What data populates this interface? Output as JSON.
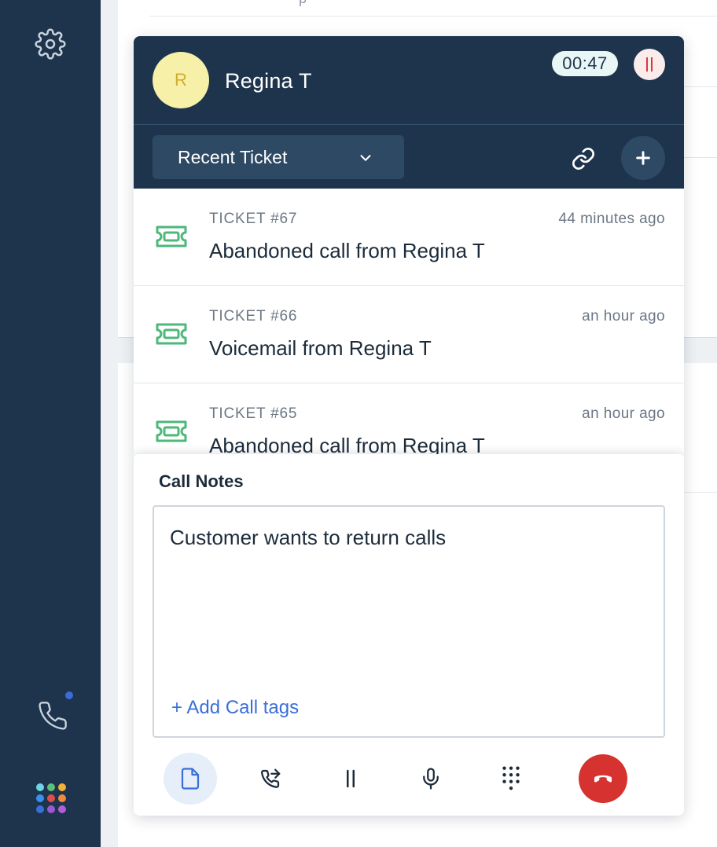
{
  "sidebar": {
    "icons": [
      "gear-icon",
      "phone-icon",
      "apps-grid-icon"
    ],
    "notification_color": "#3c6ad6",
    "app_dot_colors": [
      "#6fd3e6",
      "#5cc07a",
      "#f2b233",
      "#3b8ff0",
      "#e14c4c",
      "#ef8a3d",
      "#3a6fd8",
      "#9b59d0",
      "#b05fd6"
    ]
  },
  "background": {
    "ghost_text": "p"
  },
  "call": {
    "caller_initial": "R",
    "caller_name": "Regina T",
    "timer": "00:47",
    "status": "on-hold"
  },
  "ticket_select": {
    "label": "Recent Ticket"
  },
  "tickets": [
    {
      "number": "TICKET #67",
      "time": "44 minutes ago",
      "title": "Abandoned call from Regina T"
    },
    {
      "number": "TICKET #66",
      "time": "an hour ago",
      "title": "Voicemail from Regina T"
    },
    {
      "number": "TICKET #65",
      "time": "an hour ago",
      "title": "Abandoned call from Regina T"
    }
  ],
  "notes": {
    "title": "Call Notes",
    "text": "Customer wants to return calls",
    "add_tags_label": "+ Add Call tags"
  },
  "toolbar": {
    "buttons": [
      "notes-icon",
      "transfer-icon",
      "hold-icon",
      "microphone-icon",
      "keypad-icon",
      "hangup-icon"
    ]
  },
  "colors": {
    "navy": "#1e344d",
    "ticket_icon": "#4cb87a",
    "hangup": "#d6322f",
    "link": "#3a6fd8"
  }
}
